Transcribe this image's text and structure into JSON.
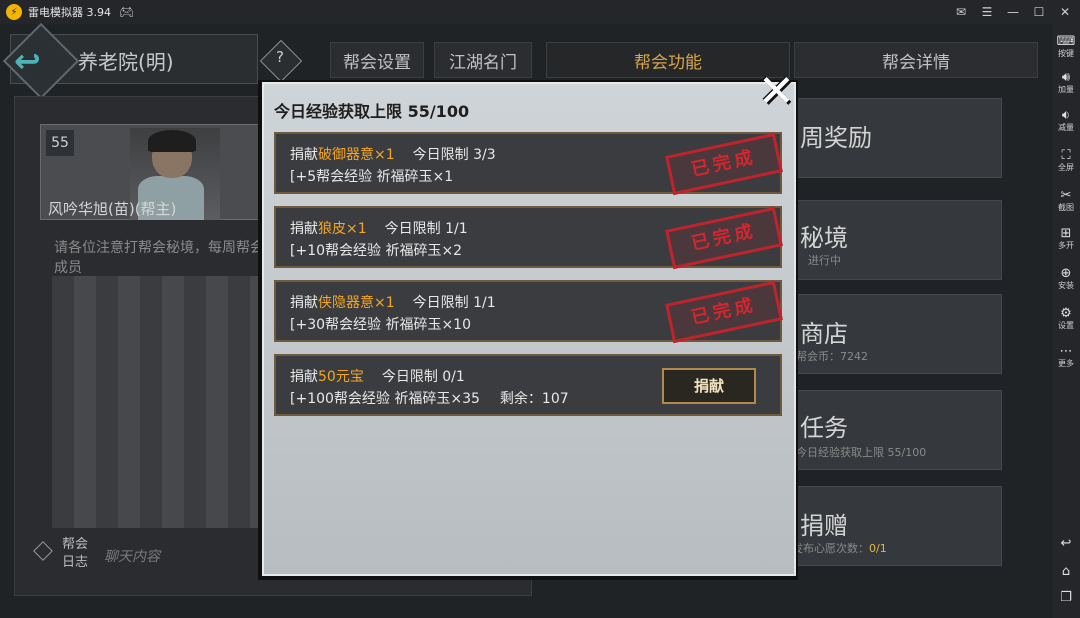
{
  "emulator": {
    "title": "雷电模拟器 3.94",
    "sidebar": [
      {
        "icon": "keyboard-icon",
        "label": "按键"
      },
      {
        "icon": "volume-up-icon",
        "label": "加量"
      },
      {
        "icon": "volume-down-icon",
        "label": "减量"
      },
      {
        "icon": "fullscreen-icon",
        "label": "全屏"
      },
      {
        "icon": "scissors-icon",
        "label": "截图"
      },
      {
        "icon": "multi-instance-icon",
        "label": "多开"
      },
      {
        "icon": "apk-install-icon",
        "label": "安装"
      },
      {
        "icon": "settings-icon",
        "label": "设置"
      },
      {
        "icon": "more-icon",
        "label": "更多"
      }
    ]
  },
  "header": {
    "location": "养老院(明)",
    "tabs": [
      "帮会设置",
      "江湖名门",
      "帮会功能",
      "帮会详情"
    ],
    "active_tab": "帮会功能"
  },
  "leader": {
    "level": "55",
    "name": "风吟华旭(苗)(帮主)"
  },
  "notice": "请各位注意打帮会秘境，每周帮会成员",
  "log": {
    "label": "帮会日志",
    "chat_placeholder": "聊天内容"
  },
  "functions": [
    {
      "title": "周奖励",
      "sub": "",
      "sub_value": ""
    },
    {
      "title": "秘境",
      "sub": "进行中",
      "sub_value": ""
    },
    {
      "title": "商店",
      "sub": "帮会币：7242",
      "sub_value": ""
    },
    {
      "title": "任务",
      "sub": "今日经验获取上限 55/100",
      "sub_value": ""
    },
    {
      "title": "捐赠",
      "sub": "发布心愿次数：",
      "sub_value": "0/1"
    }
  ],
  "modal": {
    "title": "今日经验获取上限 55/100",
    "completed_label": "已完成",
    "donate_label": "捐献",
    "tasks": [
      {
        "prefix": "捐献",
        "item": "破御器意×1",
        "limit": "今日限制 3/3",
        "reward": "[+5帮会经验  祈福碎玉×1",
        "remain": "",
        "status": "completed"
      },
      {
        "prefix": "捐献",
        "item": "狼皮×1",
        "limit": "今日限制 1/1",
        "reward": "[+10帮会经验  祈福碎玉×2",
        "remain": "",
        "status": "completed"
      },
      {
        "prefix": "捐献",
        "item": "侠隐器意×1",
        "limit": "今日限制 1/1",
        "reward": "[+30帮会经验  祈福碎玉×10",
        "remain": "",
        "status": "completed"
      },
      {
        "prefix": "捐献",
        "item": "50元宝",
        "limit": "今日限制 0/1",
        "reward": "[+100帮会经验  祈福碎玉×35",
        "remain": "剩余：107",
        "status": "available"
      }
    ]
  }
}
